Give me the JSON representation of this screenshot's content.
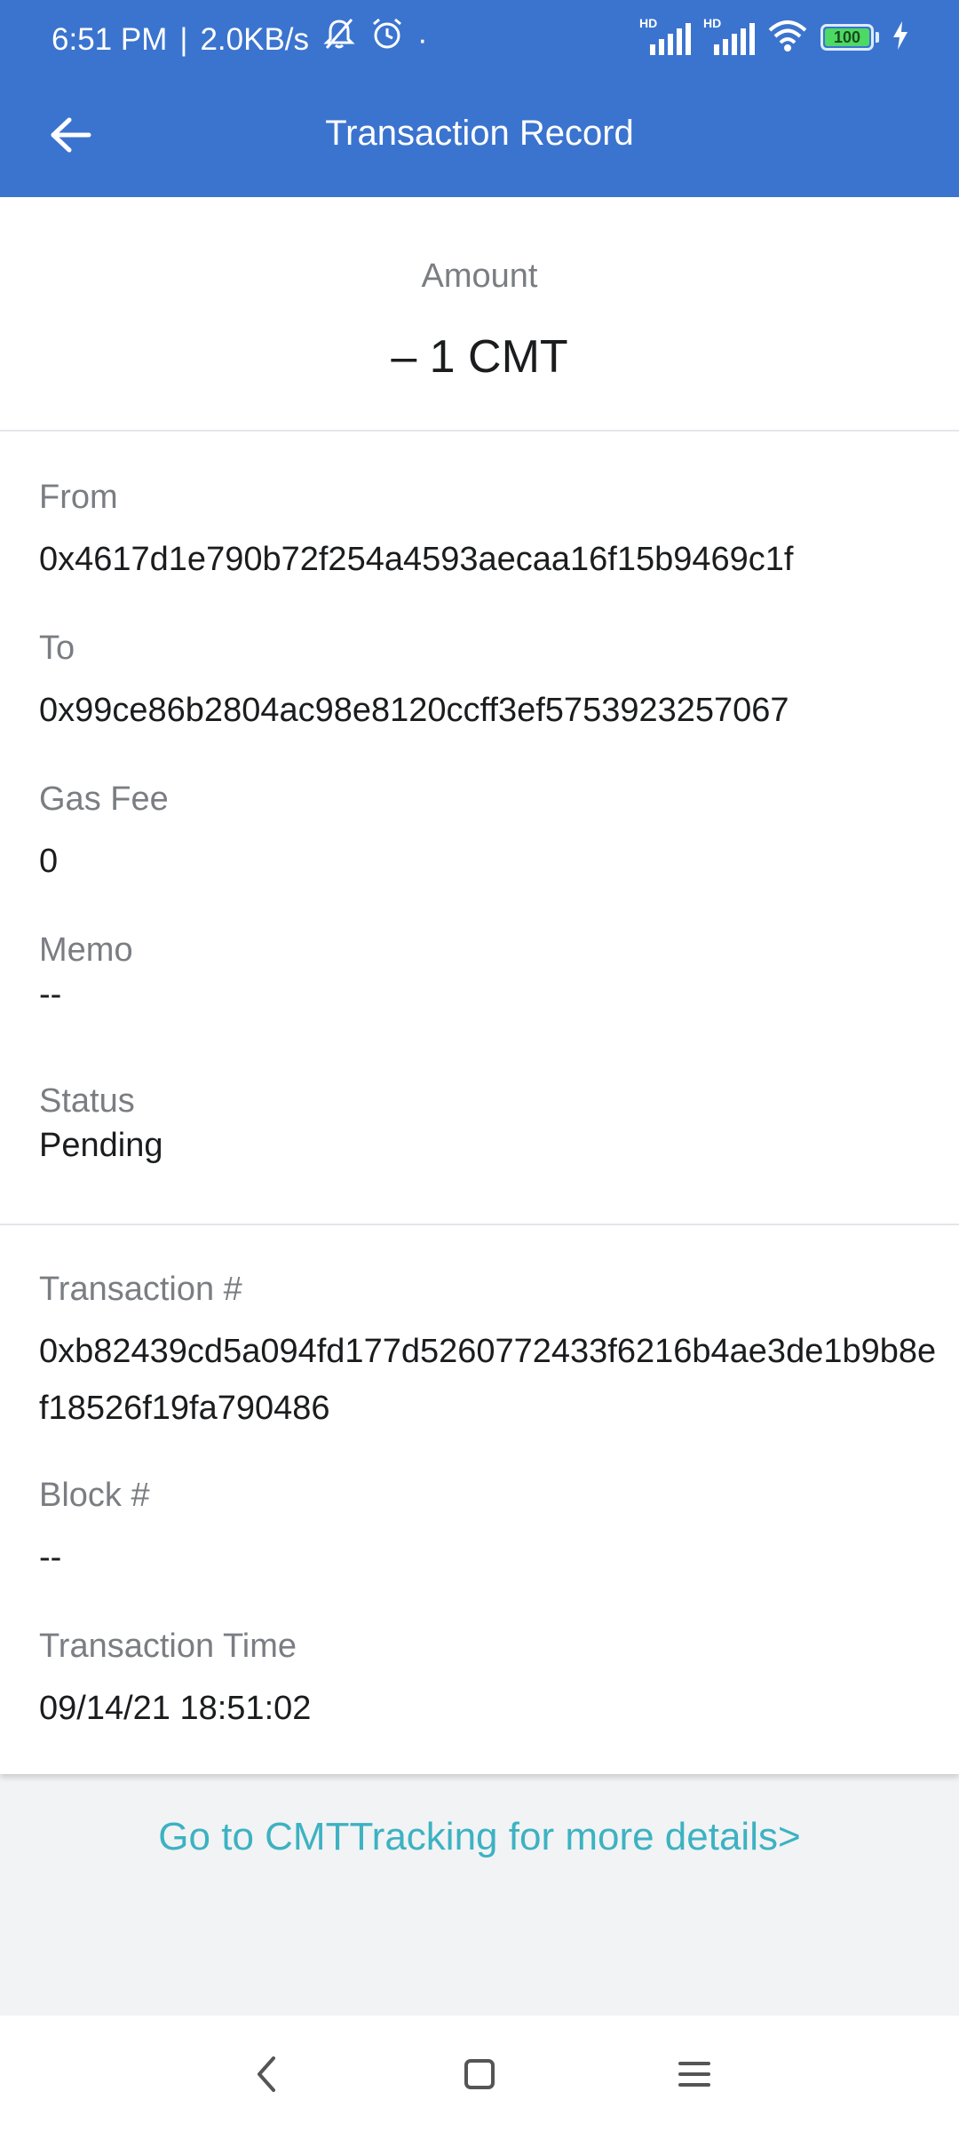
{
  "status_bar": {
    "time": "6:51 PM",
    "separator": "|",
    "speed": "2.0KB/s",
    "dot": "·",
    "icons": [
      "mute-icon",
      "alarm-icon",
      "hd-signal-icon",
      "hd-signal-icon",
      "wifi-icon",
      "battery-icon",
      "charging-icon"
    ],
    "hd_label": "HD",
    "battery": "100"
  },
  "toolbar": {
    "back_icon": "back-arrow-icon",
    "title": "Transaction Record"
  },
  "amount": {
    "label": "Amount",
    "value": "– 1 CMT"
  },
  "details": {
    "from_label": "From",
    "from_value": "0x4617d1e790b72f254a4593aecaa16f15b9469c1f",
    "to_label": "To",
    "to_value": "0x99ce86b2804ac98e8120ccff3ef5753923257067",
    "gas_label": "Gas Fee",
    "gas_value": "0",
    "memo_label": "Memo",
    "memo_value": "--",
    "status_label": "Status",
    "status_value": "Pending"
  },
  "transaction": {
    "hash_label": "Transaction #",
    "hash_value": "0xb82439cd5a094fd177d5260772433f6216b4ae3de1b9b8ef18526f19fa790486",
    "block_label": "Block #",
    "block_value": "--",
    "time_label": "Transaction Time",
    "time_value": "09/14/21 18:51:02"
  },
  "more_link": "Go to CMTTracking for more details>",
  "nav": {
    "icons": [
      "nav-back-icon",
      "nav-home-icon",
      "nav-menu-icon"
    ]
  },
  "colors": {
    "header": "#3b74cf",
    "link": "#3cb2c2",
    "background": "#f2f3f5"
  }
}
